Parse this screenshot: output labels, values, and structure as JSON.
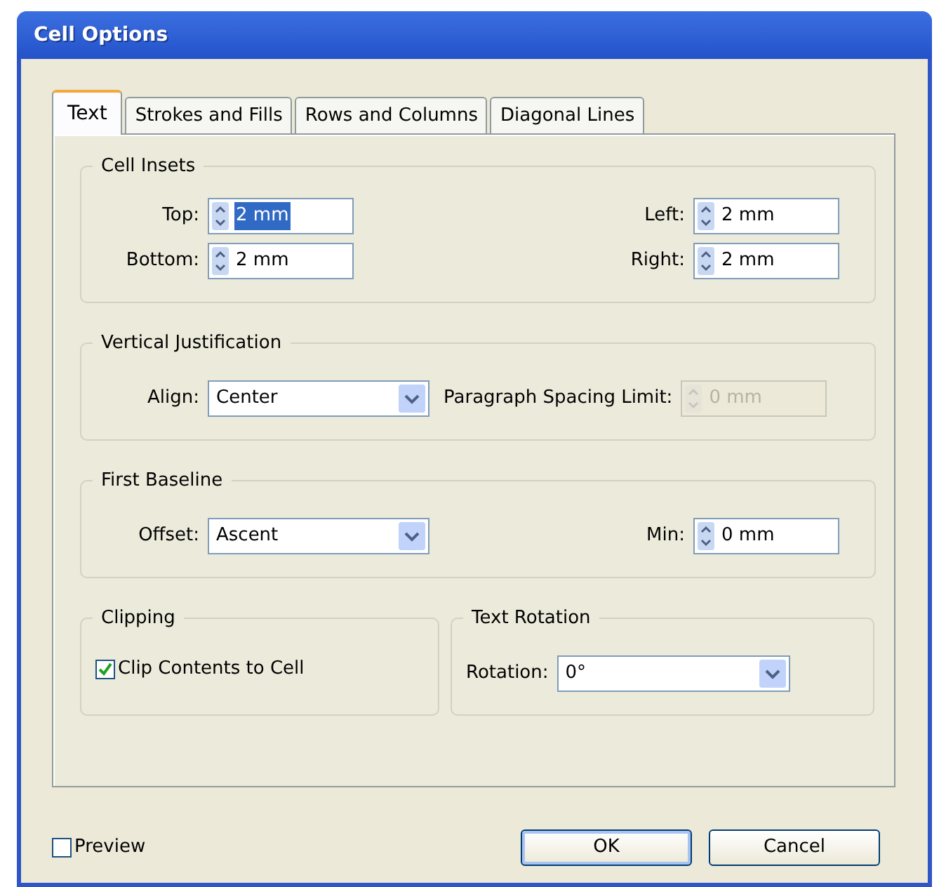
{
  "window": {
    "title": "Cell Options"
  },
  "tabs": [
    {
      "label": "Text",
      "selected": true
    },
    {
      "label": "Strokes and Fills",
      "selected": false
    },
    {
      "label": "Rows and Columns",
      "selected": false
    },
    {
      "label": "Diagonal Lines",
      "selected": false
    }
  ],
  "cell_insets": {
    "title": "Cell Insets",
    "fields": [
      {
        "label": "Top:",
        "value": "2 mm",
        "highlighted": true
      },
      {
        "label": "Left:",
        "value": "2 mm",
        "highlighted": false
      },
      {
        "label": "Bottom:",
        "value": "2 mm",
        "highlighted": false
      },
      {
        "label": "Right:",
        "value": "2 mm",
        "highlighted": false
      }
    ]
  },
  "vertical_justification": {
    "title": "Vertical Justification",
    "align": {
      "label": "Align:",
      "value": "Center"
    },
    "spacing_limit": {
      "label": "Paragraph Spacing Limit:",
      "value": "0 mm",
      "disabled": true
    }
  },
  "first_baseline": {
    "title": "First Baseline",
    "offset": {
      "label": "Offset:",
      "value": "Ascent"
    },
    "min": {
      "label": "Min:",
      "value": "0 mm",
      "disabled": false
    }
  },
  "clipping": {
    "title": "Clipping",
    "checkbox": {
      "label": "Clip Contents to Cell",
      "checked": true
    }
  },
  "text_rotation": {
    "title": "Text Rotation",
    "rotation": {
      "label": "Rotation:",
      "value": "0°"
    }
  },
  "preview": {
    "label": "Preview",
    "checked": false
  },
  "buttons": [
    {
      "label": "OK",
      "default": true
    },
    {
      "label": "Cancel",
      "default": false
    }
  ]
}
